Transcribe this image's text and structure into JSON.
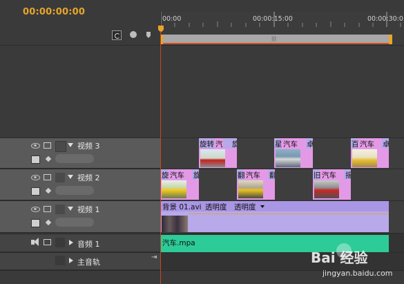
{
  "timecode": "00:00:00:00",
  "ruler": {
    "t0": "00:00",
    "t1": "00:00:15:00",
    "t2": "00:00:30:0"
  },
  "ruler_slider_grip": "|||",
  "tracks": {
    "video3": {
      "label": "视频 3"
    },
    "video2": {
      "label": "视频 2"
    },
    "video1": {
      "label": "视频 1",
      "clip_name": "背景 01.avi",
      "opacity1": "透明度",
      "opacity2": "透明度"
    },
    "audio1": {
      "label": "音频 1",
      "clip_name": "汽车.mpa"
    },
    "master": {
      "label": "主音轨"
    }
  },
  "v3_clips": [
    {
      "a": "旋转",
      "b": "汽",
      "c": "旋"
    },
    {
      "a": "星",
      "b": "汽车",
      "c": "卓"
    },
    {
      "a": "百",
      "b": "汽车",
      "c": "卓"
    }
  ],
  "v2_clips": [
    {
      "a": "旋",
      "b": "汽车",
      "c": "旋"
    },
    {
      "a": "翻",
      "b": "汽车",
      "c": "翻"
    },
    {
      "a": "旧",
      "b": "汽车",
      "c": "摇"
    }
  ],
  "watermark": {
    "brand": "Bai 经验",
    "url": "jingyan.baidu.com"
  },
  "colors": {
    "timecode": "#e8a52a",
    "playhead": "#c8471e",
    "clip_pink": "#e39ae6",
    "clip_purple": "#b6a6e8",
    "audio_clip": "#2dcb97"
  }
}
